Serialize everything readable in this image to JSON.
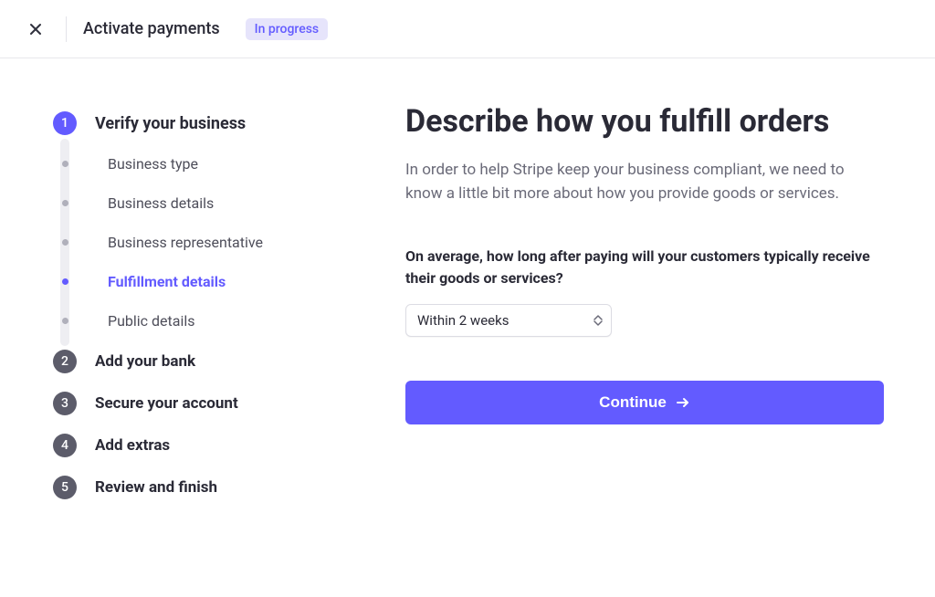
{
  "header": {
    "title": "Activate payments",
    "badge": "In progress"
  },
  "nav": {
    "step1": {
      "number": "1",
      "label": "Verify your business",
      "subs": [
        {
          "label": "Business type",
          "current": false
        },
        {
          "label": "Business details",
          "current": false
        },
        {
          "label": "Business representative",
          "current": false
        },
        {
          "label": "Fulfillment details",
          "current": true
        },
        {
          "label": "Public details",
          "current": false
        }
      ]
    },
    "step2": {
      "number": "2",
      "label": "Add your bank"
    },
    "step3": {
      "number": "3",
      "label": "Secure your account"
    },
    "step4": {
      "number": "4",
      "label": "Add extras"
    },
    "step5": {
      "number": "5",
      "label": "Review and finish"
    }
  },
  "main": {
    "heading": "Describe how you fulfill orders",
    "lead": "In order to help Stripe keep your business compliant, we need to know a little bit more about how you provide goods or services.",
    "question": "On average, how long after paying will your customers typically receive their goods or services?",
    "select_value": "Within 2 weeks",
    "continue_label": "Continue"
  },
  "colors": {
    "accent": "#635bff",
    "badge_bg": "#e6e4fb"
  }
}
